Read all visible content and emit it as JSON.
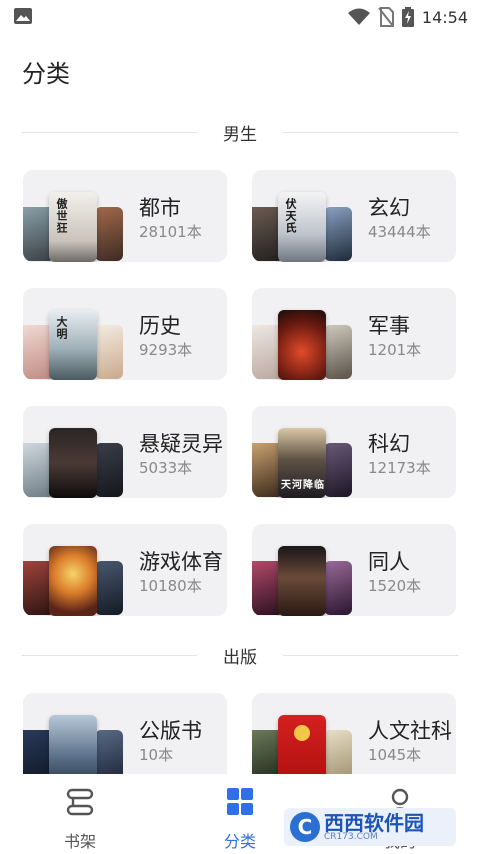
{
  "status_bar": {
    "time": "14:54"
  },
  "page": {
    "title": "分类"
  },
  "sections": [
    {
      "title": "男生"
    },
    {
      "title": "出版"
    }
  ],
  "categories": [
    {
      "name": "都市",
      "count": "28101本",
      "cover_title": "傲世狂"
    },
    {
      "name": "玄幻",
      "count": "43444本",
      "cover_title": "伏天氏"
    },
    {
      "name": "历史",
      "count": "9293本",
      "cover_title": "大明"
    },
    {
      "name": "军事",
      "count": "1201本",
      "cover_title": ""
    },
    {
      "name": "悬疑灵异",
      "count": "5033本",
      "cover_title": ""
    },
    {
      "name": "科幻",
      "count": "12173本",
      "cover_title": "天河降临"
    },
    {
      "name": "游戏体育",
      "count": "10180本",
      "cover_title": ""
    },
    {
      "name": "同人",
      "count": "1520本",
      "cover_title": ""
    },
    {
      "name": "公版书",
      "count": "10本",
      "cover_title": ""
    },
    {
      "name": "人文社科",
      "count": "1045本",
      "cover_title": ""
    }
  ],
  "bottom_nav": {
    "shelf": "书架",
    "category": "分类",
    "me": "我的"
  },
  "watermark": {
    "main": "西西软件园",
    "sub": "CR173.COM",
    "logo": "C"
  },
  "colors": {
    "accent": "#2f6fe8",
    "card_bg": "#f1f1f3",
    "text": "#222222",
    "muted": "#888888"
  },
  "icons": [
    "image-icon",
    "wifi-icon",
    "no-sim-icon",
    "battery-charging-icon",
    "bookshelf-icon",
    "grid-icon",
    "person-icon"
  ]
}
